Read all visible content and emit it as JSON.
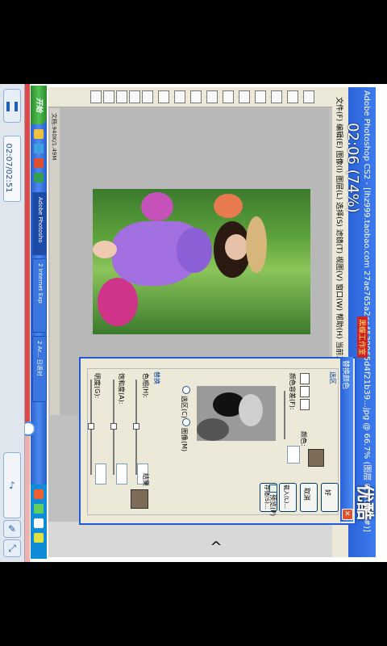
{
  "player": {
    "time_label": "02:07/02:51",
    "progress_fraction": 0.72,
    "overlay_time": "02:06 (74%)",
    "watermark": "优酷"
  },
  "desktop": {
    "start_label": "开始",
    "taskbar_items": [
      "Adobe Photosho",
      "2 Internet Exp",
      "2 Ar... 日语对"
    ]
  },
  "photoshop": {
    "title": "Adobe Photoshop CS2 - [lhz999.taobao.com 27ae765a2cc4539065d4f21b39...jpg @ 66.7% (图层 0, RGB/8#)]",
    "menu": "文件(F)  编辑(E)  图像(I)  图层(L)  选择(S)  滤镜(T)  视图(V)  窗口(W)  帮助(H)   当前工具点击蒸排",
    "doc_title": "文档:940K/1.49M",
    "brand_badge": "黑蝶工作室"
  },
  "dialog": {
    "title": "替换颜色",
    "selection_label": "选区",
    "fuzz_label": "颜色容差(F):",
    "radio_selection": "选区(C)",
    "radio_image": "图像(M)",
    "replace_label": "替换",
    "hue_label": "色相(H):",
    "sat_label": "饱和度(A):",
    "light_label": "明度(G):",
    "result_label": "结果",
    "ok": "好",
    "cancel": "取消",
    "load": "载入(L)...",
    "save": "存储(S)...",
    "preview_label": "预览(P)",
    "sample_label": "颜色:",
    "colors": {
      "result": "#7d6b58",
      "accent": "#1f5bd8"
    }
  }
}
